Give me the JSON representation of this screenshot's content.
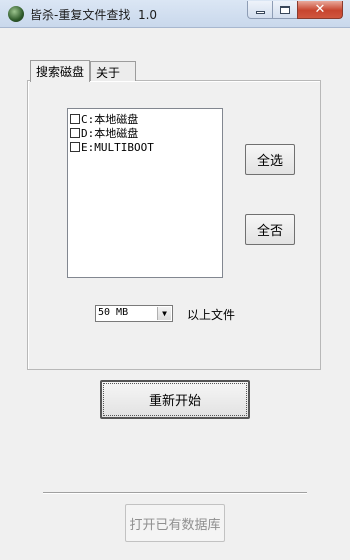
{
  "window": {
    "title": "皆杀-重复文件查找  1.0",
    "close_symbol": "✕"
  },
  "tabs": [
    {
      "label": "搜索磁盘",
      "active": true
    },
    {
      "label": "关于",
      "active": false
    }
  ],
  "drives": [
    {
      "label": "C:本地磁盘",
      "checked": false
    },
    {
      "label": "D:本地磁盘",
      "checked": false
    },
    {
      "label": "E:MULTIBOOT",
      "checked": false
    }
  ],
  "buttons": {
    "select_all": "全选",
    "select_none": "全否",
    "restart": "重新开始",
    "open_db": "打开已有数据库"
  },
  "size_filter": {
    "value": "50 MB",
    "suffix_label": "以上文件"
  },
  "icons": {
    "dropdown": "▼"
  }
}
